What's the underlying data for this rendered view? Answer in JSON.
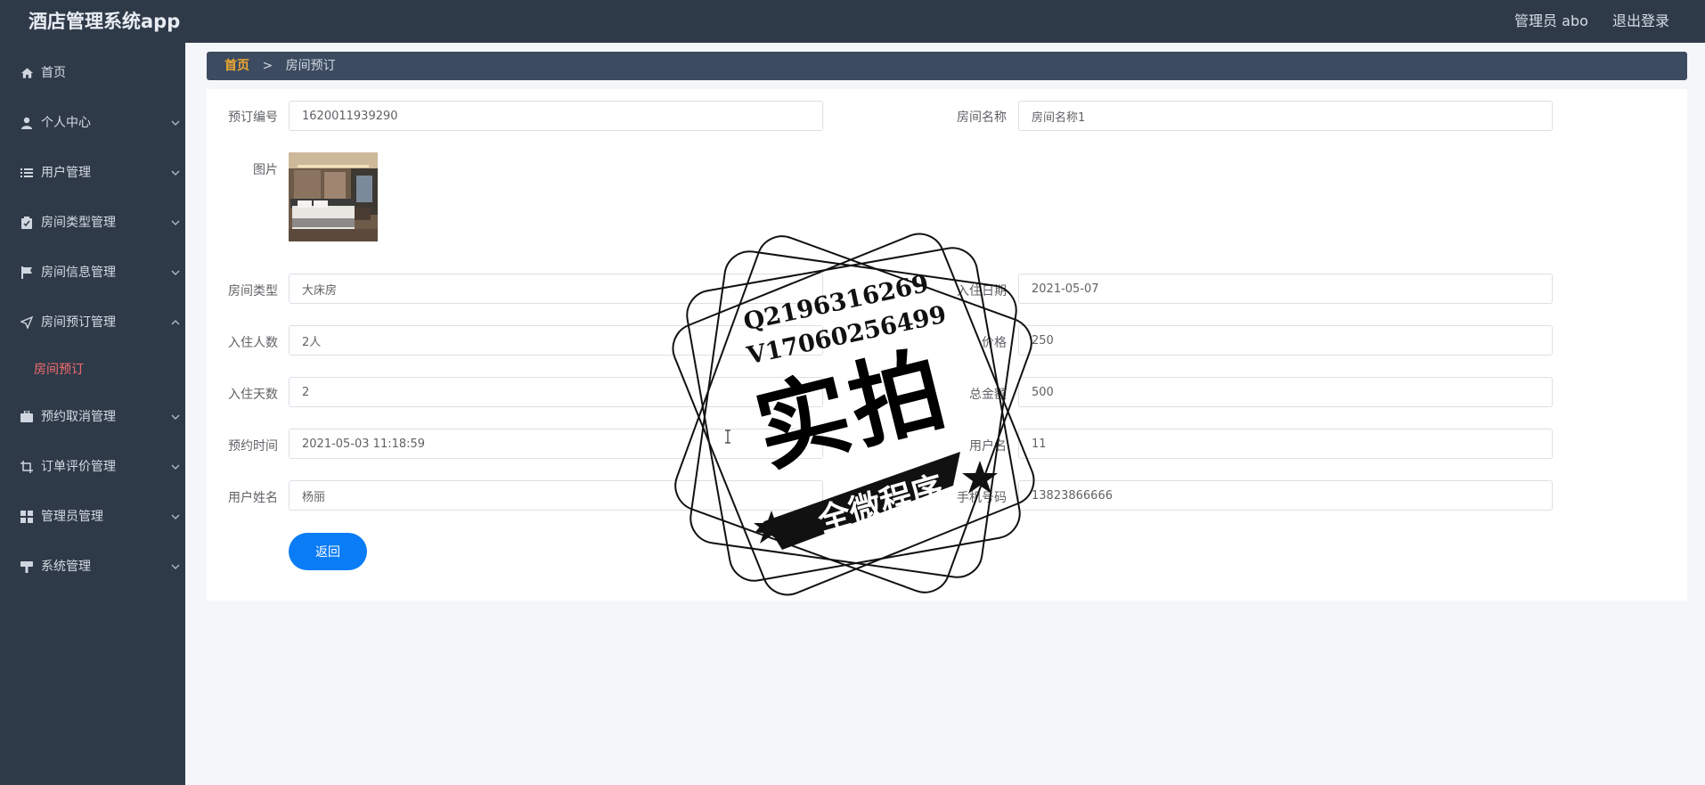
{
  "header": {
    "app_title": "酒店管理系统app",
    "admin_label": "管理员 abo",
    "logout_label": "退出登录"
  },
  "sidebar": {
    "items": [
      {
        "label": "首页",
        "icon": "home-icon",
        "expandable": false
      },
      {
        "label": "个人中心",
        "icon": "user-icon",
        "expandable": true
      },
      {
        "label": "用户管理",
        "icon": "list-icon",
        "expandable": true
      },
      {
        "label": "房间类型管理",
        "icon": "clipboard-icon",
        "expandable": true
      },
      {
        "label": "房间信息管理",
        "icon": "flag-icon",
        "expandable": true
      },
      {
        "label": "房间预订管理",
        "icon": "send-icon",
        "expandable": true,
        "expanded": true
      },
      {
        "label": "预约取消管理",
        "icon": "briefcase-icon",
        "expandable": true
      },
      {
        "label": "订单评价管理",
        "icon": "crop-icon",
        "expandable": true
      },
      {
        "label": "管理员管理",
        "icon": "grid-icon",
        "expandable": true
      },
      {
        "label": "系统管理",
        "icon": "sign-icon",
        "expandable": true
      }
    ],
    "active_sub_item": "房间预订",
    "accent_color": "#f56c6c"
  },
  "breadcrumb": {
    "home": "首页",
    "separator": ">",
    "current": "房间预订"
  },
  "form": {
    "order_no_label": "预订编号",
    "order_no_value": "1620011939290",
    "room_name_label": "房间名称",
    "room_name_value": "房间名称1",
    "image_label": "图片",
    "room_type_label": "房间类型",
    "room_type_value": "大床房",
    "checkin_date_label": "入住日期",
    "checkin_date_value": "2021-05-07",
    "guests_label": "入住人数",
    "guests_value": "2人",
    "price_label": "价格",
    "price_value": "250",
    "days_label": "入住天数",
    "days_value": "2",
    "total_label": "总金额",
    "total_value": "500",
    "booking_time_label": "预约时间",
    "booking_time_value": "2021-05-03 11:18:59",
    "username_label": "用户名",
    "username_value": "11",
    "realname_label": "用户姓名",
    "realname_value": "杨丽",
    "phone_label": "手机号码",
    "phone_value": "13823866666",
    "back_label": "返回",
    "button_color": "#0a7cf5"
  },
  "watermark": {
    "line1": "Q2196316269",
    "line2": "V17060256499",
    "big_text": "实拍",
    "banner_text": "全微程序"
  }
}
